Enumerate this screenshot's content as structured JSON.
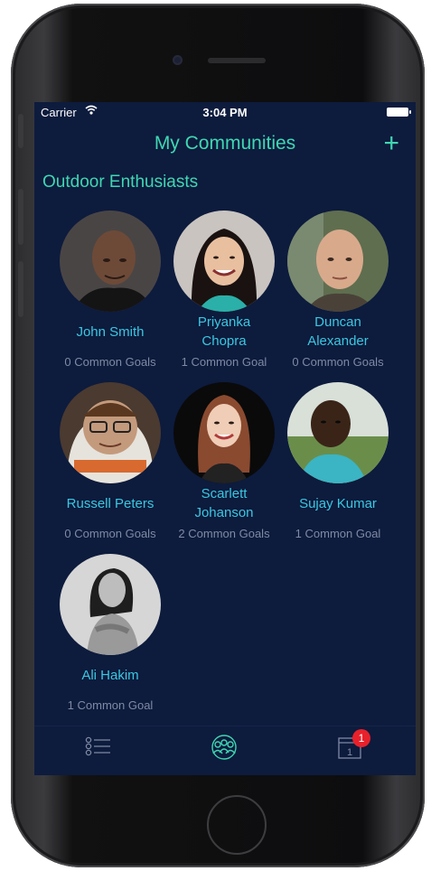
{
  "status_bar": {
    "carrier": "Carrier",
    "time": "3:04 PM"
  },
  "nav": {
    "title": "My Communities",
    "add_label": "+"
  },
  "community": {
    "name": "Outdoor Enthusiasts"
  },
  "members": [
    {
      "name": "John Smith",
      "goals": "0 Common Goals"
    },
    {
      "name": "Priyanka\nChopra",
      "goals": "1 Common Goal"
    },
    {
      "name": "Duncan\nAlexander",
      "goals": "0 Common Goals"
    },
    {
      "name": "Russell Peters",
      "goals": "0 Common Goals"
    },
    {
      "name": "Scarlett\nJohanson",
      "goals": "2 Common Goals"
    },
    {
      "name": "Sujay Kumar",
      "goals": "1 Common Goal"
    },
    {
      "name": "Ali Hakim",
      "goals": "1 Common Goal"
    }
  ],
  "tabbar": {
    "tabs": [
      {
        "icon": "list-icon",
        "active": false
      },
      {
        "icon": "community-icon",
        "active": true
      },
      {
        "icon": "calendar-icon",
        "active": false,
        "calendar_day": "1",
        "badge": "1"
      }
    ]
  },
  "colors": {
    "accent": "#3fd7b2",
    "name": "#3bc7e0",
    "background": "#0d1b3d",
    "badge": "#e8212b"
  }
}
